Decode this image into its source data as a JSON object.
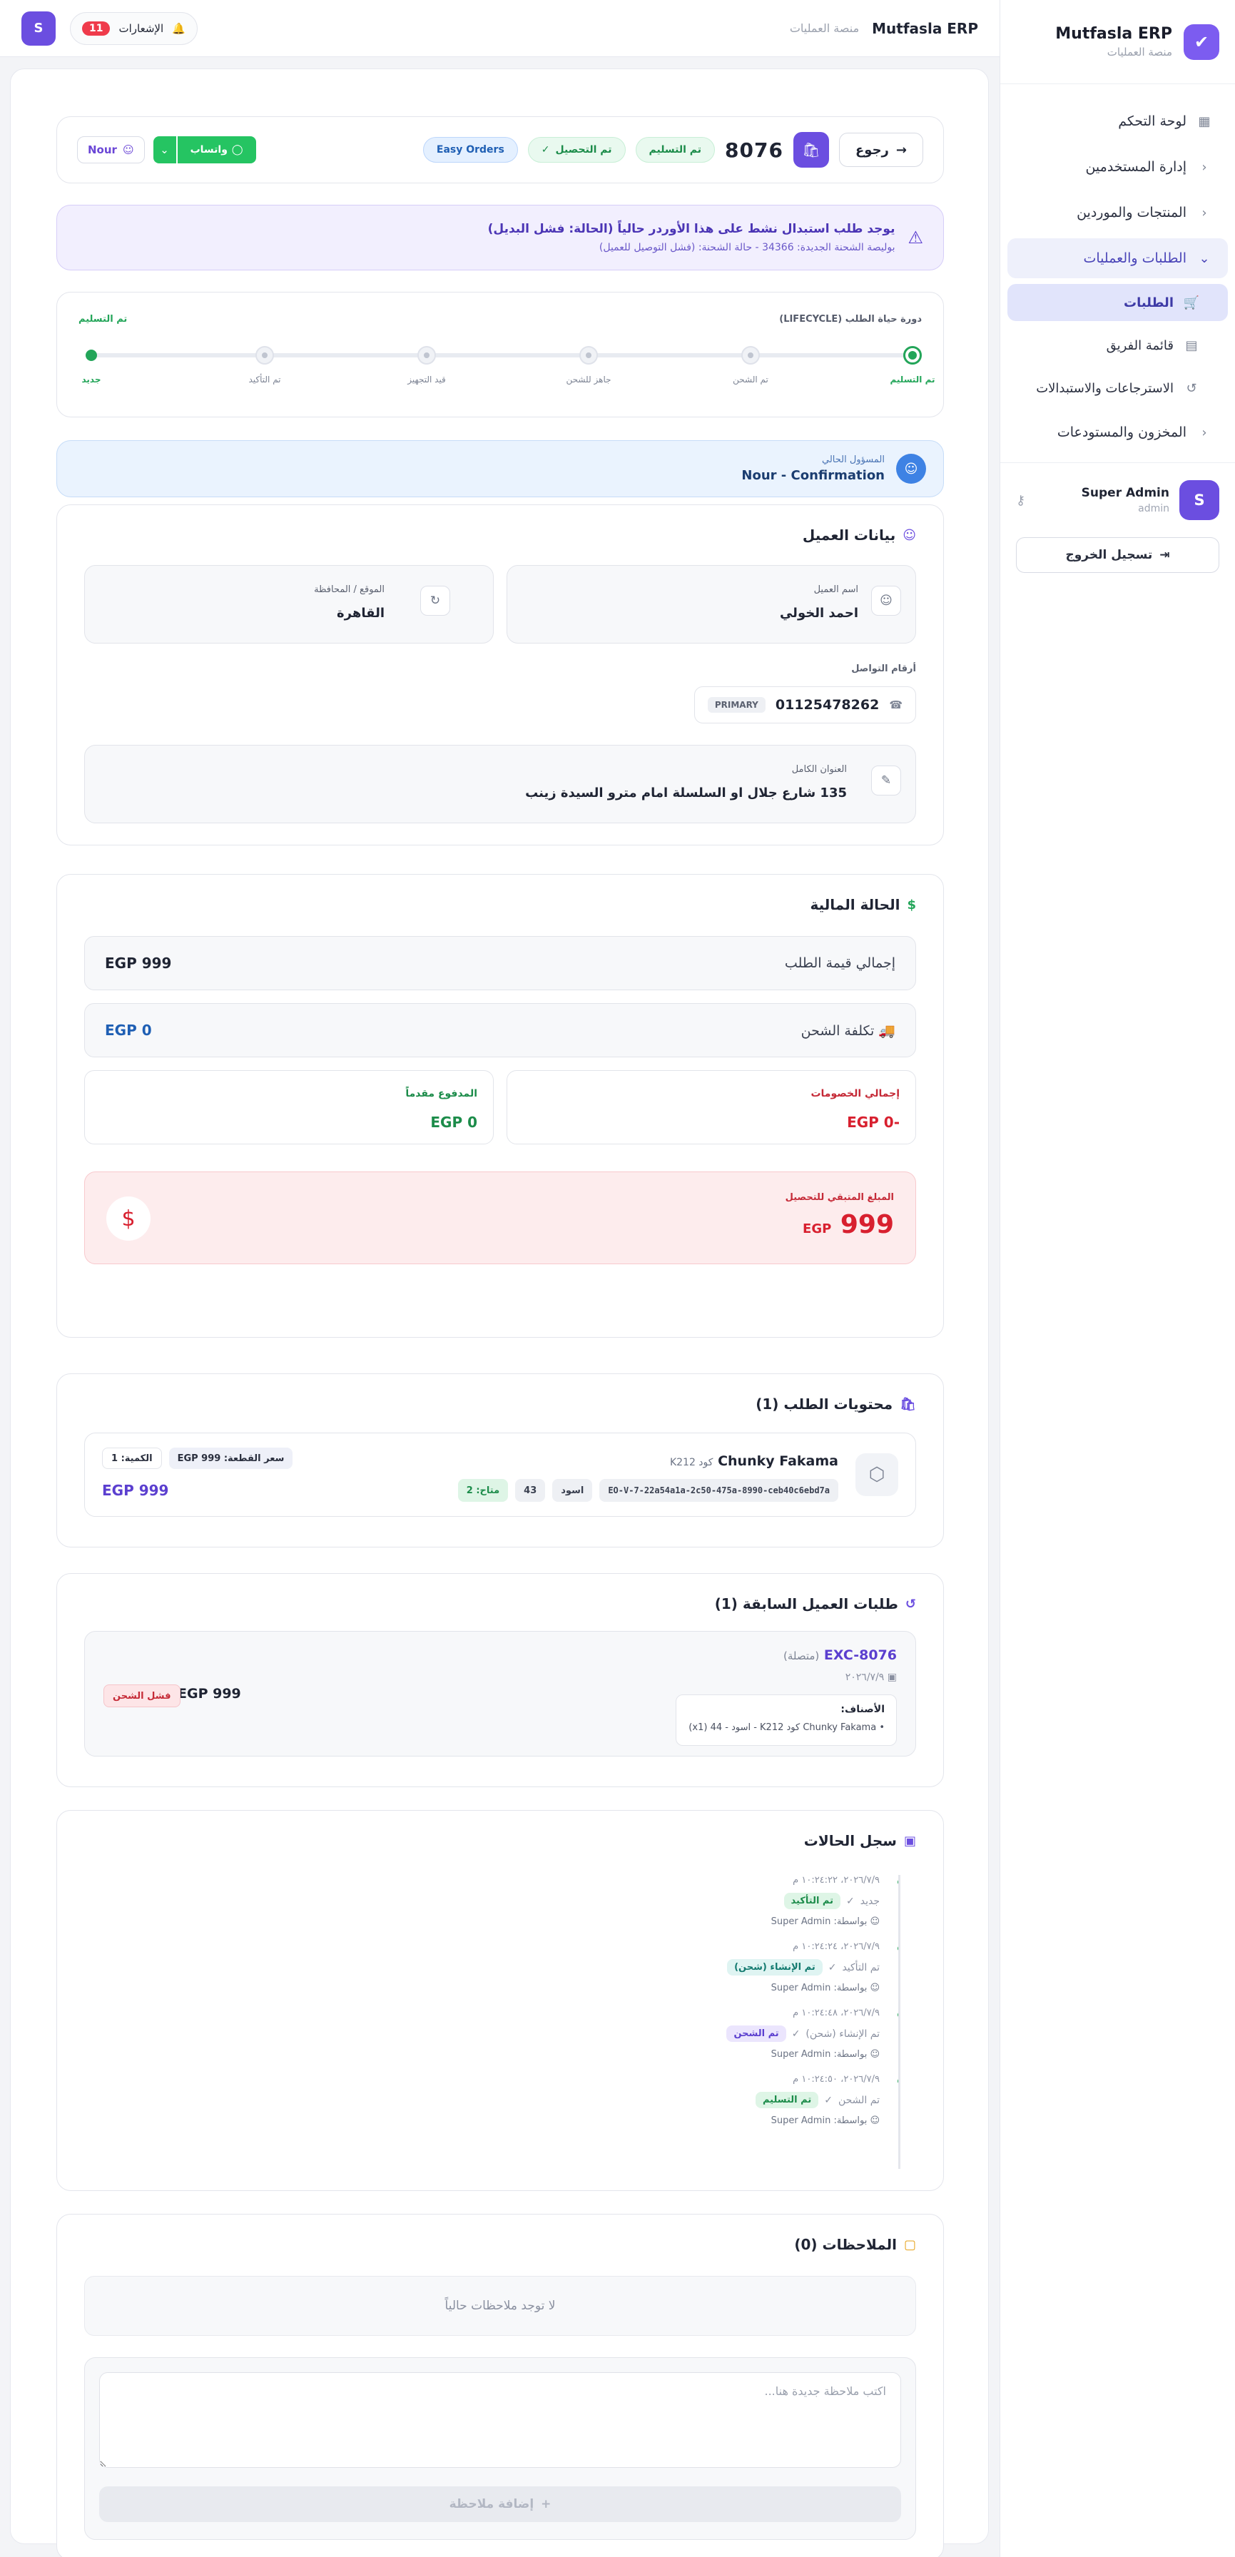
{
  "sidebar": {
    "brand_title": "Mutfasla ERP",
    "brand_sub": "منصة العمليات",
    "items": [
      {
        "label": "لوحة التحكم",
        "icon": "grid-icon"
      },
      {
        "label": "إدارة المستخدمين",
        "icon": "chevron-left-icon"
      },
      {
        "label": "المنتجات والموردين",
        "icon": "chevron-left-icon"
      },
      {
        "label": "الطلبات والعمليات",
        "icon": "chevron-down-icon"
      },
      {
        "label": "المخزون والمستودعات",
        "icon": "chevron-left-icon"
      }
    ],
    "sub_items": [
      {
        "label": "الطلبات",
        "icon": "cart-icon"
      },
      {
        "label": "قائمة الفريق",
        "icon": "clipboard-icon"
      },
      {
        "label": "الاسترجاعات والاستبدالات",
        "icon": "rotate-icon"
      }
    ],
    "user": {
      "initial": "S",
      "name": "Super Admin",
      "role": "admin"
    },
    "logout_label": "تسجيل الخروج"
  },
  "topbar": {
    "title": "Mutfasla ERP",
    "subtitle": "منصة العمليات",
    "notif_label": "الإشعارات",
    "notif_count": "11",
    "user_initial": "S"
  },
  "order": {
    "back_label": "رجوع",
    "number": "8076",
    "status_delivered": "تم التسليم",
    "status_collected": "تم التحصيل",
    "source": "Easy Orders",
    "whatsapp_label": "واتساب",
    "assignee": "Nour"
  },
  "alert": {
    "title": "يوجد طلب استبدال نشط على هذا الأوردر حالياً (الحالة: فشل البديل)",
    "detail": "بوليصة الشحنة الجديدة: 34366 - حالة الشحنة: (فشل التوصيل للعميل)"
  },
  "lifecycle": {
    "title": "دورة حياة الطلب (LIFECYCLE)",
    "current": "تم التسليم",
    "steps": [
      "تم التسليم",
      "تم الشحن",
      "جاهز للشحن",
      "قيد التجهيز",
      "تم التأكيد",
      "جديد"
    ]
  },
  "responsible": {
    "label": "المسؤول الحالي",
    "value": "Nour - Confirmation"
  },
  "customer": {
    "title": "بيانات العميل",
    "name_label": "اسم العميل",
    "name": "احمد الخولي",
    "region_label": "الموقع / المحافظة",
    "region": "القاهرة",
    "phones_label": "أرقام التواصل",
    "phone": "01125478262",
    "phone_badge": "PRIMARY",
    "address_label": "العنوان الكامل",
    "address": "135 شارع جلال او السلسلة امام مترو السيدة زينب"
  },
  "finance": {
    "title": "الحالة المالية",
    "total_label": "إجمالي قيمة الطلب",
    "total": "EGP 999",
    "shipping_label": "تكلفة الشحن",
    "shipping": "EGP 0",
    "discount_label": "إجمالي الخصومات",
    "discount": "EGP 0-",
    "paid_label": "المدفوع مقدماً",
    "paid": "EGP 0",
    "due_label": "المبلغ المتبقي للتحصيل",
    "due_amount": "999",
    "due_currency": "EGP"
  },
  "items": {
    "title": "محتويات الطلب (1)",
    "list": [
      {
        "name": "Chunky Fakama",
        "code": "كود K212",
        "sku": "EO-V-7-22a54a1a-2c50-475a-8990-ceb40c6ebd7a",
        "color": "اسود",
        "size": "43",
        "stock": "متاح: 2",
        "unit_price": "سعر القطعة: EGP 999",
        "qty": "الكمية: 1",
        "total": "EGP 999"
      }
    ]
  },
  "previous": {
    "title": "طلبات العميل السابقة (1)",
    "code": "EXC-8076",
    "code_note": "(متصلة)",
    "date": "٢٠٢٦/٧/٩",
    "items_title": "الأصناف:",
    "item_line": "Chunky Fakama كود K212 - اسود - 44 (x1)",
    "amount": "EGP 999",
    "status": "فشل الشحن"
  },
  "history": {
    "title": "سجل الحالات",
    "events": [
      {
        "date": "٢٠٢٦/٧/٩، ١٠:٢٤:٢٢ م",
        "from": "جديد",
        "to": "تم التأكيد",
        "tone": "g",
        "by": "بواسطة: Super Admin"
      },
      {
        "date": "٢٠٢٦/٧/٩، ١٠:٢٤:٢٤ م",
        "from": "تم التأكيد",
        "to": "تم الإنشاء (شحن)",
        "tone": "c",
        "by": "بواسطة: Super Admin"
      },
      {
        "date": "٢٠٢٦/٧/٩، ١٠:٢٤:٤٨ م",
        "from": "تم الإنشاء (شحن)",
        "to": "تم الشحن",
        "tone": "p",
        "by": "بواسطة: Super Admin"
      },
      {
        "date": "٢٠٢٦/٧/٩، ١٠:٢٤:٥٠ م",
        "from": "تم الشحن",
        "to": "تم التسليم",
        "tone": "g",
        "by": "بواسطة: Super Admin"
      }
    ]
  },
  "notes": {
    "title": "الملاحظات (0)",
    "empty": "لا توجد ملاحظات حالياً",
    "placeholder": "اكتب ملاحظة جديدة هنا...",
    "add_label": "إضافة ملاحظة"
  },
  "colors": {
    "primary": "#6b4ee0",
    "success": "#23a559",
    "danger": "#d8202f",
    "info": "#3e82e4"
  }
}
